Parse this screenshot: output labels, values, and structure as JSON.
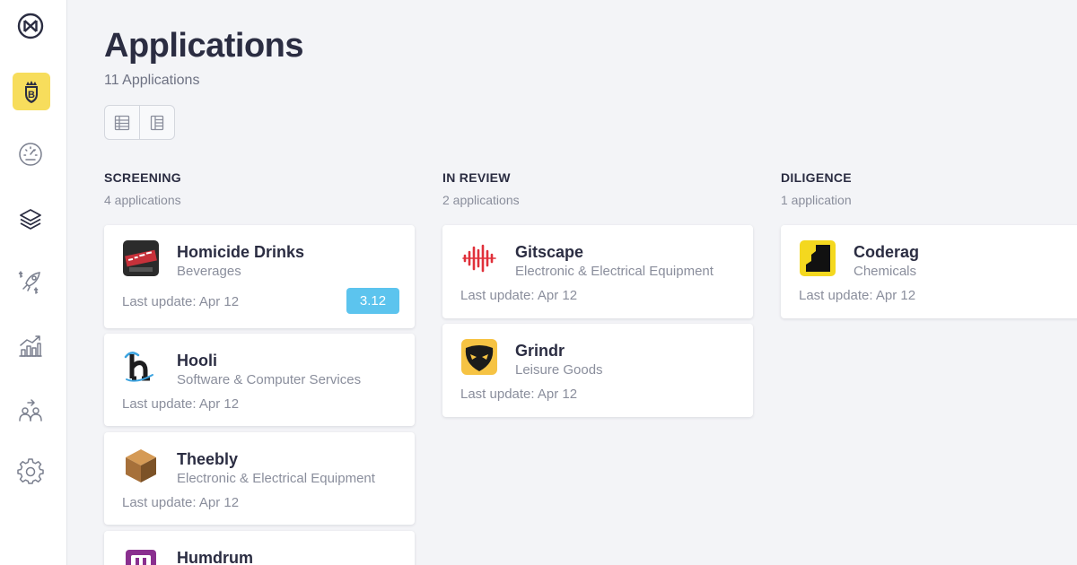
{
  "sidebar": {
    "items": [
      {
        "icon": "brand-logo-icon"
      },
      {
        "icon": "portfolio-badge-icon",
        "letter": "B",
        "active": true,
        "accent": "#f7dd5c"
      },
      {
        "icon": "dashboard-gauge-icon"
      },
      {
        "icon": "layers-icon"
      },
      {
        "icon": "funding-rocket-icon"
      },
      {
        "icon": "growth-chart-icon"
      },
      {
        "icon": "team-icon"
      },
      {
        "icon": "settings-gear-icon"
      }
    ]
  },
  "header": {
    "title": "Applications",
    "subtitle": "11 Applications",
    "view_toggle": [
      {
        "icon": "table-view-icon"
      },
      {
        "icon": "board-view-icon"
      }
    ]
  },
  "columns": [
    {
      "title": "SCREENING",
      "count": "4 applications",
      "cards": [
        {
          "name": "Homicide Drinks",
          "industry": "Beverages",
          "update": "Last update: Apr 12",
          "score": "3.12",
          "logo": "homicide-drinks-logo"
        },
        {
          "name": "Hooli",
          "industry": "Software & Computer Services",
          "update": "Last update: Apr 12",
          "logo": "hooli-logo"
        },
        {
          "name": "Theebly",
          "industry": "Electronic & Electrical Equipment",
          "update": "Last update: Apr 12",
          "logo": "theebly-cube-logo"
        },
        {
          "name": "Humdrum",
          "logo": "humdrum-logo"
        }
      ]
    },
    {
      "title": "IN REVIEW",
      "count": "2 applications",
      "cards": [
        {
          "name": "Gitscape",
          "industry": "Electronic & Electrical Equipment",
          "update": "Last update: Apr 12",
          "logo": "gitscape-waveform-logo"
        },
        {
          "name": "Grindr",
          "industry": "Leisure Goods",
          "update": "Last update: Apr 12",
          "logo": "grindr-mask-logo"
        }
      ]
    },
    {
      "title": "DILIGENCE",
      "count": "1 application",
      "cards": [
        {
          "name": "Coderag",
          "industry": "Chemicals",
          "update": "Last update: Apr 12",
          "logo": "coderag-logo"
        }
      ]
    }
  ],
  "colors": {
    "badge": "#5cc4ee",
    "active_nav": "#f7dd5c",
    "title": "#2b2d42",
    "muted": "#8a8e9c"
  }
}
